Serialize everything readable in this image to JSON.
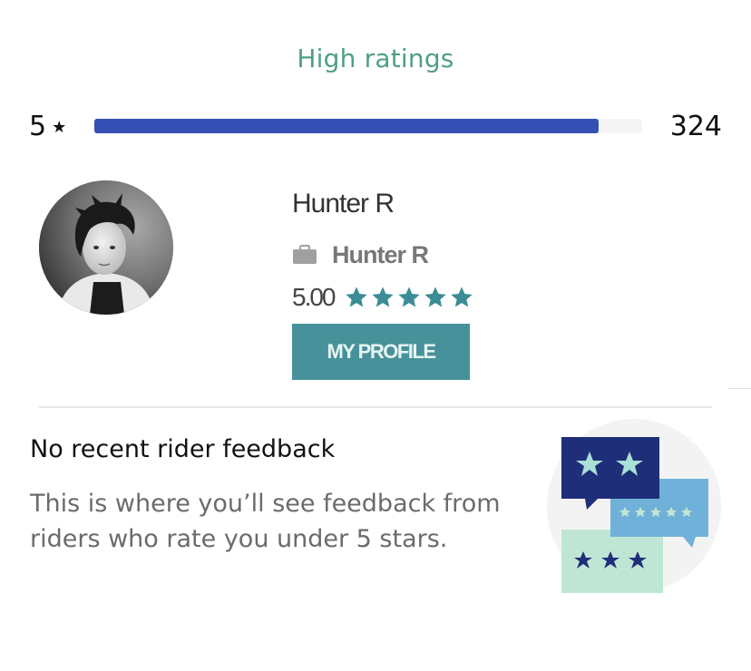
{
  "ratings": {
    "section_title": "High ratings",
    "row": {
      "label": "5",
      "star_glyph": "★",
      "count": "324",
      "fill_fraction": 0.92,
      "bar_color": "#3550b5"
    }
  },
  "profile": {
    "name": "Hunter R",
    "company_icon": "briefcase-icon",
    "company": "Hunter R",
    "rating": "5.00",
    "stars": 5,
    "star_color": "#3b8c95",
    "button_label": "MY PROFILE"
  },
  "feedback": {
    "title": "No recent rider feedback",
    "body": "This is where you’ll see feedback from riders who rate you under 5 stars.",
    "illustration_icon": "rating-chat-bubbles-icon"
  }
}
